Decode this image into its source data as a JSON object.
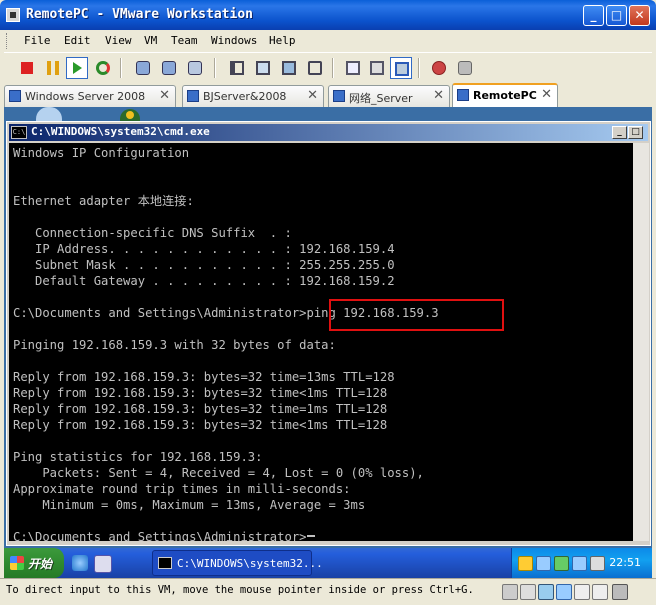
{
  "window": {
    "title": "RemotePC - VMware Workstation",
    "minimize_icon": "minimize-icon",
    "maximize_icon": "maximize-icon",
    "close_icon": "close-icon"
  },
  "menu": [
    "File",
    "Edit",
    "View",
    "VM",
    "Team",
    "Windows",
    "Help"
  ],
  "toolbar": {
    "icons": [
      "stop-icon",
      "pause-icon",
      "play-icon",
      "reset-icon",
      "snapshot-icon",
      "revert-snapshot-icon",
      "snapshot-manager-icon",
      "sidebar-icon",
      "fullscreen-icon",
      "quickswitch-icon",
      "unity-icon",
      "summary-icon",
      "console-view-icon",
      "fit-window-icon",
      "team-icon",
      "settings-icon"
    ]
  },
  "tabs": [
    {
      "label": "Windows Server 2008",
      "active": false
    },
    {
      "label": "BJServer&2008",
      "active": false
    },
    {
      "label": "网络_Server",
      "active": false
    },
    {
      "label": "RemotePC",
      "active": true
    }
  ],
  "cmd": {
    "title": "C:\\WINDOWS\\system32\\cmd.exe",
    "icon_text": "C:\\",
    "lines": [
      "Windows IP Configuration",
      "",
      "",
      "Ethernet adapter 本地连接:",
      "",
      "   Connection-specific DNS Suffix  . :",
      "   IP Address. . . . . . . . . . . . : 192.168.159.4",
      "   Subnet Mask . . . . . . . . . . . : 255.255.255.0",
      "   Default Gateway . . . . . . . . . : 192.168.159.2",
      "",
      "C:\\Documents and Settings\\Administrator>ping 192.168.159.3",
      "",
      "Pinging 192.168.159.3 with 32 bytes of data:",
      "",
      "Reply from 192.168.159.3: bytes=32 time=13ms TTL=128",
      "Reply from 192.168.159.3: bytes=32 time<1ms TTL=128",
      "Reply from 192.168.159.3: bytes=32 time=1ms TTL=128",
      "Reply from 192.168.159.3: bytes=32 time<1ms TTL=128",
      "",
      "Ping statistics for 192.168.159.3:",
      "    Packets: Sent = 4, Received = 4, Lost = 0 (0% loss),",
      "Approximate round trip times in milli-seconds:",
      "    Minimum = 0ms, Maximum = 13ms, Average = 3ms",
      "",
      "C:\\Documents and Settings\\Administrator>"
    ]
  },
  "taskbar": {
    "start_label": "开始",
    "task_label": "C:\\WINDOWS\\system32...",
    "clock": "22:51"
  },
  "status": {
    "text": "To direct input to this VM, move the mouse pointer inside or press Ctrl+G."
  },
  "colors": {
    "console_bg": "#000000",
    "console_fg": "#c0c0c0",
    "highlight": "#e01010"
  }
}
